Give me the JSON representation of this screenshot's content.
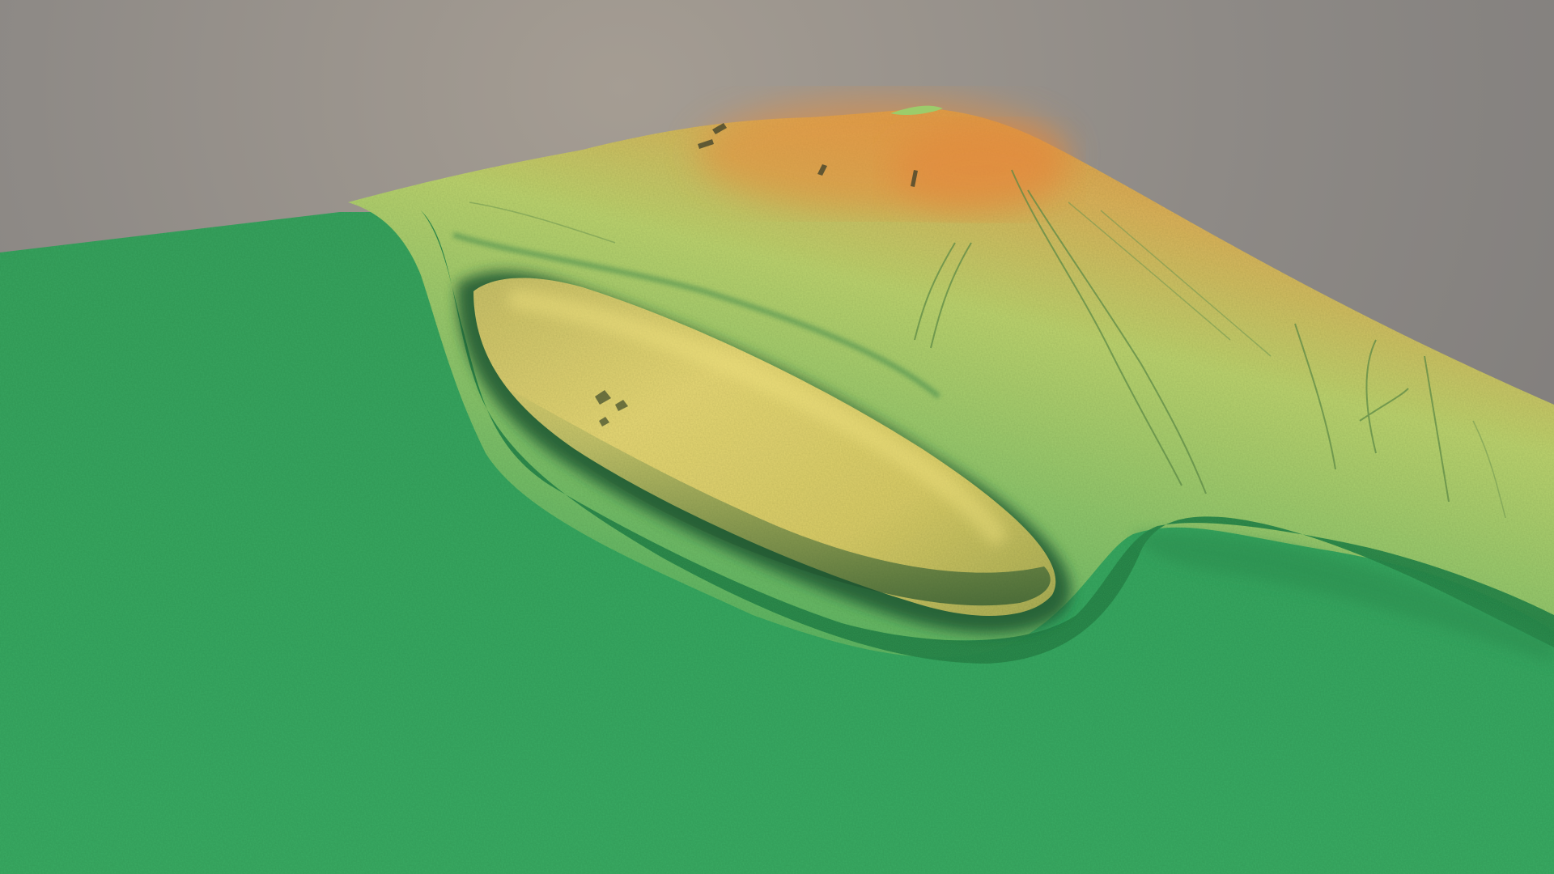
{
  "scene": {
    "kind": "3d-terrain-render",
    "colors": {
      "background_top": "#a59d93",
      "background_bottom": "#7a7877",
      "lowland": "#3aa862",
      "lowland_dark": "#2f9656",
      "slope_light_green": "#a8cf6e",
      "ridge_yellow": "#e3d56e",
      "summit_orange": "#e29a45",
      "shadow": "#1f5a35"
    },
    "features": [
      "flat-plain",
      "elongated-mound",
      "rising-hillside",
      "summit",
      "tracks",
      "scarp-edge"
    ]
  }
}
